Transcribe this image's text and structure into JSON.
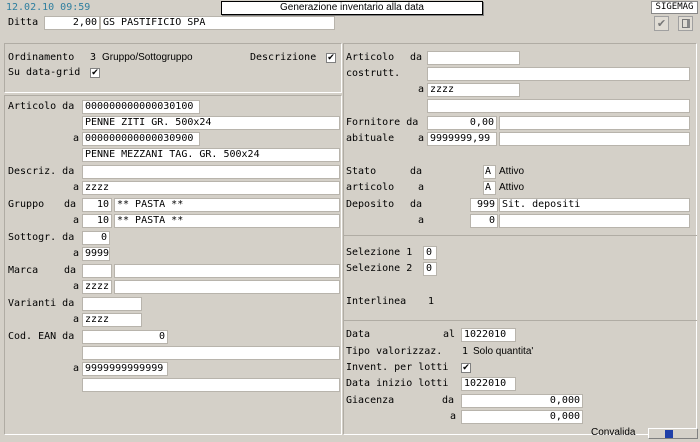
{
  "header": {
    "datetime": "12.02.10 09:59",
    "window_title": "Generazione inventario alla data",
    "app_badge": "SIGEMAG",
    "ditta_label": "Ditta",
    "ditta_value": "2,00",
    "ditta_name": "GS PASTIFICIO SPA"
  },
  "options": {
    "ordinamento_label": "Ordinamento",
    "ordinamento_value": "3",
    "ordinamento_text": "Gruppo/Sottogruppo",
    "descrizione_label": "Descrizione",
    "datagrid_label": "Su data-grid",
    "check": "✔"
  },
  "left": {
    "articolo_da_label": "Articolo da",
    "articolo_da_value": "000000000000030100",
    "articolo_da_desc": "PENNE ZITI          GR. 500x24",
    "a_label": "a",
    "da_label": "da",
    "articolo_a_value": "000000000000030900",
    "articolo_a_desc": "PENNE MEZZANI TAG. GR. 500x24",
    "descriz_label": "Descriz. da",
    "descriz_a_value": "zzzz",
    "gruppo_label": "Gruppo",
    "gruppo_da_code": "10",
    "gruppo_da_desc": "** PASTA **",
    "gruppo_a_code": "10",
    "gruppo_a_desc": "** PASTA **",
    "sottogr_label": "Sottogr. da",
    "sottogr_da_value": "0",
    "sottogr_a_value": "9999",
    "marca_label": "Marca",
    "marca_a_value": "zzzz",
    "varianti_label": "Varianti da",
    "varianti_a_value": "zzzz",
    "ean_label": "Cod. EAN da",
    "ean_da_value": "0",
    "ean_a_value": "9999999999999"
  },
  "right": {
    "articolo_label": "Articolo",
    "costrutt_label": "costrutt.",
    "da_label": "da",
    "a_label": "a",
    "art_a_value": "zzzz",
    "fornitore_label": "Fornitore da",
    "fornitore_da_value": "0,00",
    "abituale_label": "abituale",
    "abituale_a_value": "9999999,99",
    "stato_label": "Stato",
    "stato_da_code": "A",
    "stato_da_text": "Attivo",
    "articolo2_label": "articolo",
    "stato_a_code": "A",
    "stato_a_text": "Attivo",
    "deposito_label": "Deposito",
    "deposito_da_code": "999",
    "deposito_da_desc": "Sit. depositi",
    "deposito_a_code": "0",
    "sel1_label": "Selezione 1",
    "sel1_value": "0",
    "sel2_label": "Selezione 2",
    "sel2_value": "0",
    "interlinea_label": "Interlinea",
    "interlinea_value": "1",
    "data_label": "Data",
    "al_label": "al",
    "data_value": "1022010",
    "tipo_label": "Tipo  valorizzaz.",
    "tipo_value": "1",
    "tipo_text": "Solo quantita'",
    "lotti_label": "Invent. per lotti",
    "data_lotti_label": "Data inizio lotti",
    "data_lotti_value": "1022010",
    "giacenza_label": "Giacenza",
    "giac_da_value": "0,000",
    "giac_a_value": "0,000"
  },
  "footer": {
    "convalida_label": "Convalida"
  }
}
